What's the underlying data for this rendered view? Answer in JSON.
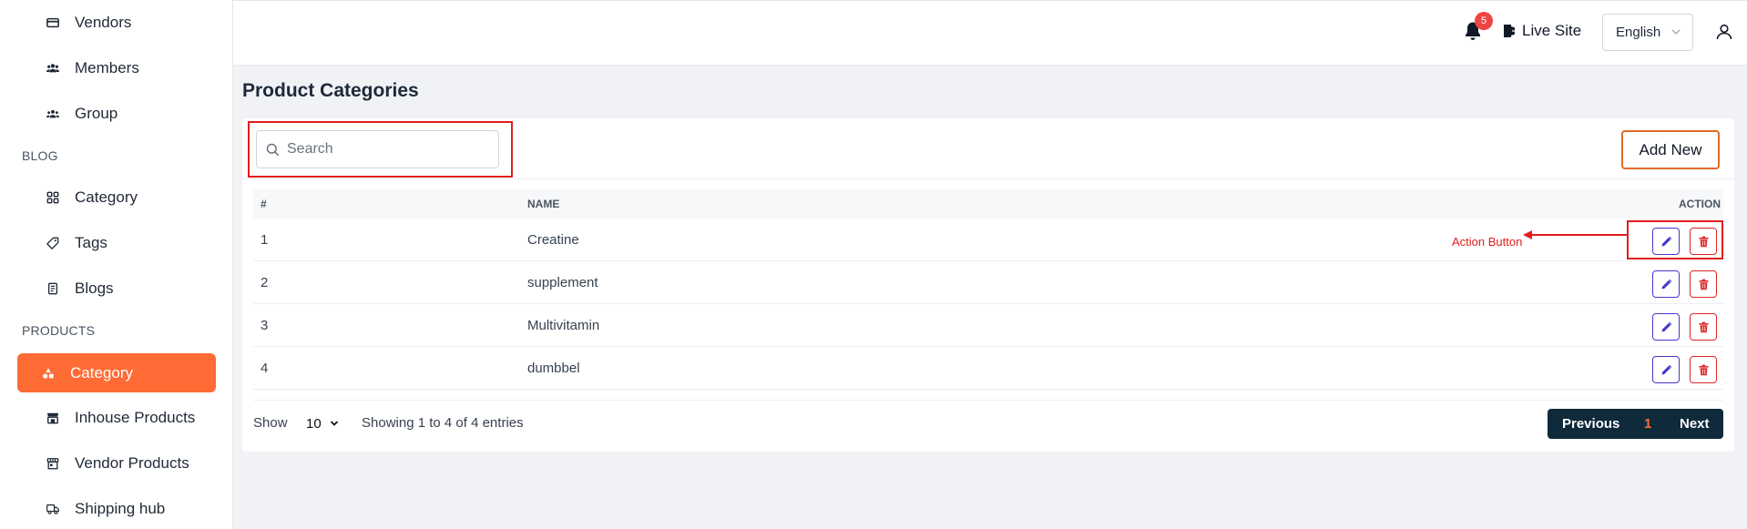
{
  "sidebar": {
    "items_top": [
      {
        "label": "Vendors",
        "icon": "card-icon"
      },
      {
        "label": "Members",
        "icon": "users-icon"
      },
      {
        "label": "Group",
        "icon": "group-icon"
      }
    ],
    "blog_section": "BLOG",
    "blog_items": [
      {
        "label": "Category",
        "icon": "grid-icon"
      },
      {
        "label": "Tags",
        "icon": "tag-icon"
      },
      {
        "label": "Blogs",
        "icon": "document-icon"
      }
    ],
    "products_section": "PRODUCTS",
    "product_items": [
      {
        "label": "Category",
        "icon": "shapes-icon",
        "active": true
      },
      {
        "label": "Inhouse Products",
        "icon": "store-icon"
      },
      {
        "label": "Vendor Products",
        "icon": "shop-icon"
      },
      {
        "label": "Shipping hub",
        "icon": "truck-icon"
      }
    ],
    "active_color": "#ff6b35"
  },
  "header": {
    "notification_count": "5",
    "live_site_label": "Live Site",
    "language": "English"
  },
  "main": {
    "title": "Product Categories",
    "search_placeholder": "Search",
    "add_new_label": "Add New",
    "columns": [
      "#",
      "NAME",
      "ACTION"
    ],
    "rows": [
      {
        "num": "1",
        "name": "Creatine"
      },
      {
        "num": "2",
        "name": "supplement"
      },
      {
        "num": "3",
        "name": "Multivitamin"
      },
      {
        "num": "4",
        "name": "dumbbel"
      }
    ],
    "annotation": "Action Button",
    "footer": {
      "show_label": "Show",
      "page_size": "10",
      "entries_text": "Showing 1 to 4 of 4 entries",
      "previous_label": "Previous",
      "current_page": "1",
      "next_label": "Next"
    }
  }
}
